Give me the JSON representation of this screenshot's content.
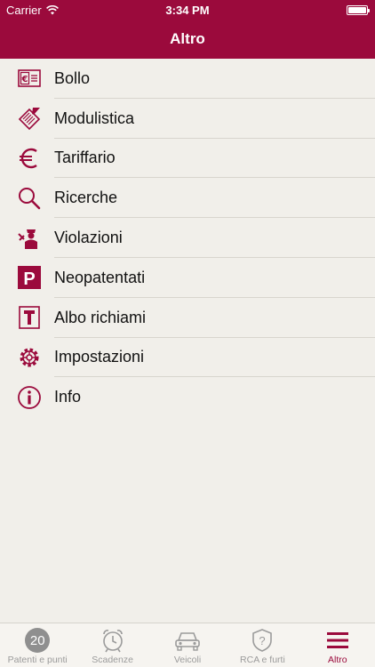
{
  "status_bar": {
    "carrier": "Carrier",
    "time": "3:34 PM"
  },
  "header": {
    "title": "Altro"
  },
  "menu": {
    "items": [
      {
        "label": "Bollo",
        "icon": "bollo-euro-card-icon"
      },
      {
        "label": "Modulistica",
        "icon": "forms-pen-icon"
      },
      {
        "label": "Tariffario",
        "icon": "euro-icon"
      },
      {
        "label": "Ricerche",
        "icon": "search-icon"
      },
      {
        "label": "Violazioni",
        "icon": "police-officer-icon"
      },
      {
        "label": "Neopatentati",
        "icon": "parking-p-icon"
      },
      {
        "label": "Albo richiami",
        "icon": "recall-board-icon"
      },
      {
        "label": "Impostazioni",
        "icon": "gear-icon"
      },
      {
        "label": "Info",
        "icon": "info-icon"
      }
    ]
  },
  "tabbar": {
    "tabs": [
      {
        "label": "Patenti e punti",
        "badge": "20",
        "icon": "points-badge-icon"
      },
      {
        "label": "Scadenze",
        "icon": "alarm-clock-icon"
      },
      {
        "label": "Veicoli",
        "icon": "car-icon"
      },
      {
        "label": "RCA e furti",
        "icon": "shield-question-icon"
      },
      {
        "label": "Altro",
        "icon": "hamburger-menu-icon",
        "active": true
      }
    ]
  },
  "colors": {
    "brand": "#9b0a3c",
    "background": "#f1efea",
    "inactive_tab": "#9b9b9b"
  }
}
